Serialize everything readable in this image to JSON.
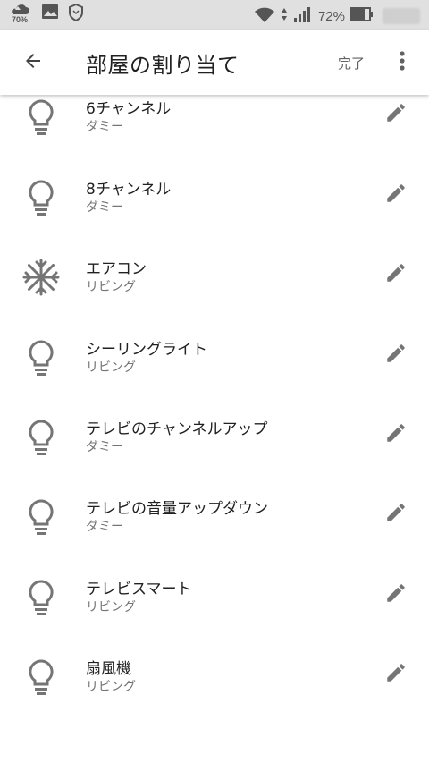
{
  "status_bar": {
    "weather_percent": "70%",
    "battery_percent": "72%"
  },
  "app_bar": {
    "title": "部屋の割り当て",
    "done_label": "完了",
    "back_icon": "arrow-back-icon",
    "more_icon": "more-vert-icon"
  },
  "devices": [
    {
      "name": "6チャンネル",
      "room": "ダミー",
      "icon": "lightbulb-icon"
    },
    {
      "name": "8チャンネル",
      "room": "ダミー",
      "icon": "lightbulb-icon"
    },
    {
      "name": "エアコン",
      "room": "リビング",
      "icon": "snowflake-icon"
    },
    {
      "name": "シーリングライト",
      "room": "リビング",
      "icon": "lightbulb-icon"
    },
    {
      "name": "テレビのチャンネルアップ",
      "room": "ダミー",
      "icon": "lightbulb-icon"
    },
    {
      "name": "テレビの音量アップダウン",
      "room": "ダミー",
      "icon": "lightbulb-icon"
    },
    {
      "name": "テレビスマート",
      "room": "リビング",
      "icon": "lightbulb-icon"
    },
    {
      "name": "扇風機",
      "room": "リビング",
      "icon": "lightbulb-icon"
    }
  ],
  "colors": {
    "icon_gray": "#757575",
    "status_bar_bg": "#e0e0e0"
  }
}
